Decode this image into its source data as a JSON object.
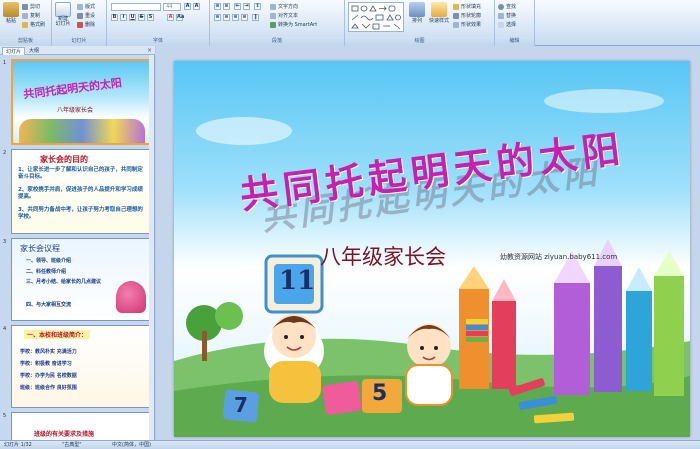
{
  "ribbon": {
    "clipboard": {
      "paste": "粘贴",
      "cut": "剪切",
      "copy": "复制",
      "format_painter": "格式刷",
      "label": "剪贴板"
    },
    "slides": {
      "new_slide": "新建\n幻灯片",
      "layout": "版式",
      "reset": "重设",
      "delete": "删除",
      "label": "幻灯片"
    },
    "font": {
      "font_size": "44",
      "label": "字体"
    },
    "paragraph": {
      "text_direction": "文字方向",
      "align_text": "对齐文本",
      "smartart": "转换为 SmartArt",
      "label": "段落"
    },
    "drawing": {
      "arrange": "排列",
      "quick_styles": "快速样式",
      "shape_fill": "形状填充",
      "shape_outline": "形状轮廓",
      "shape_effects": "形状效果",
      "label": "绘图"
    },
    "editing": {
      "find": "查找",
      "replace": "替换",
      "select": "选择",
      "label": "编辑"
    }
  },
  "pane": {
    "tabs": [
      "幻灯片",
      "大纲"
    ],
    "thumbs": [
      {
        "num": "1",
        "title": "共同托起明天的太阳",
        "subtitle": "八年级家长会"
      },
      {
        "num": "2",
        "heading": "家长会的目的",
        "lines": [
          "1、让家长进一步了解和认识自己的孩子，共同制定奋斗目标。",
          "2、家校携手并肩，促进孩子的人品提升和学习成绩提高。",
          "3、共同努力备战中考，让孩子努力考取自己理想的学校。"
        ]
      },
      {
        "num": "3",
        "heading": "家长会议程",
        "lines": [
          "一、领导、班级介绍",
          "二、科任教师介绍",
          "三、月考小结、给家长的几点建议",
          "四、与大家相互交流"
        ]
      },
      {
        "num": "4",
        "heading": "一、本校和班级简介：",
        "lines": [
          "学校：教风朴实 充满活力",
          "学校：积极教 奋进学习",
          "学校：办学为民 名校数据",
          "班级：班级合作 良好氛围"
        ]
      },
      {
        "num": "5",
        "heading": "班级的有关要求及措施"
      }
    ]
  },
  "slide": {
    "title": "共同托起明天的太阳",
    "subtitle": "八年级家长会",
    "watermark": "幼教资源网站 ziyuan.baby611.com",
    "sign_number": "11",
    "block_numbers": [
      "5",
      "7"
    ]
  },
  "status": {
    "slide_info": "幻灯片 1/32",
    "theme": "\"古典型\"",
    "language": "中文(简体，中国)"
  }
}
